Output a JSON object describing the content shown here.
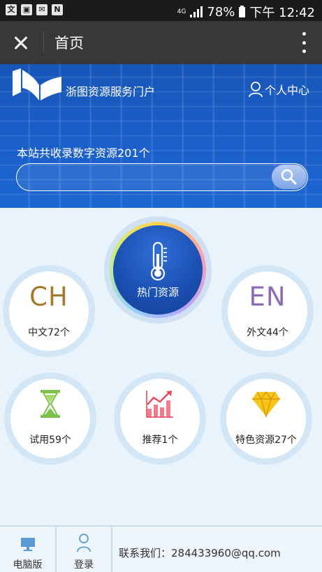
{
  "status_bar": {
    "network": "4G",
    "battery": "78%",
    "time": "下午 12:42"
  },
  "titlebar": {
    "title": "首页"
  },
  "banner": {
    "site_name": "浙图资源服务门户",
    "user_center": "个人中心",
    "resource_count_text": "本站共收录数字资源201个",
    "search_placeholder": ""
  },
  "categories": {
    "hot": {
      "label": "热门资源"
    },
    "chinese": {
      "glyph": "CH",
      "label": "中文72个"
    },
    "foreign": {
      "glyph": "EN",
      "label": "外文44个"
    },
    "trial": {
      "label": "试用59个"
    },
    "recommend": {
      "label": "推荐1个"
    },
    "featured": {
      "label": "特色资源27个"
    }
  },
  "bottom_bar": {
    "desktop_label": "电脑版",
    "login_label": "登录",
    "contact": "联系我们：284433960@qq.com"
  },
  "colors": {
    "banner_blue": "#1a5dc6",
    "ch_gold": "#a67a2e",
    "en_purple": "#8c6bb8"
  }
}
